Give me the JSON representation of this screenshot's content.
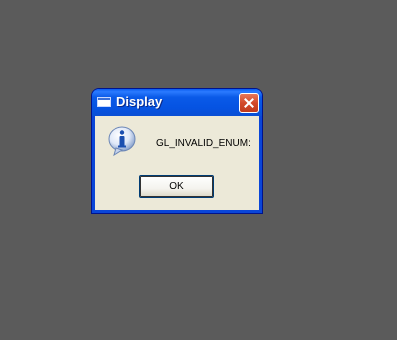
{
  "dialog": {
    "title": "Display",
    "message": "GL_INVALID_ENUM:",
    "ok_label": "OK",
    "icon": "information-icon"
  },
  "colors": {
    "desktop": "#5b5b5b",
    "titlebar": "#0553e2",
    "dialog_body": "#ece9d8",
    "close_button": "#d2492a"
  }
}
